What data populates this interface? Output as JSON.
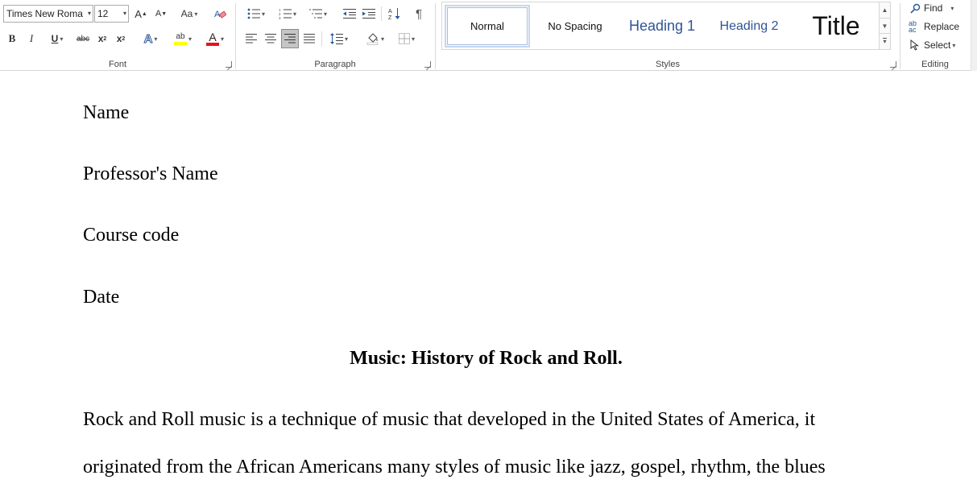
{
  "ribbon": {
    "font": {
      "group_label": "Font",
      "font_name": "Times New Roma",
      "font_size": "12",
      "grow_label": "A",
      "shrink_label": "A",
      "case_label": "Aa",
      "bold": "B",
      "italic": "I",
      "underline": "U",
      "strike": "abc",
      "subscript": "x",
      "superscript": "x",
      "effects": "A",
      "highlight": "ab",
      "font_color": "A",
      "highlight_color": "#ffff00",
      "font_color_bar": "#e81123"
    },
    "paragraph": {
      "group_label": "Paragraph",
      "pilcrow": "¶"
    },
    "styles": {
      "group_label": "Styles",
      "items": [
        {
          "label": "Normal"
        },
        {
          "label": "No Spacing"
        },
        {
          "label": "Heading 1"
        },
        {
          "label": "Heading 2"
        },
        {
          "label": "Title"
        }
      ]
    },
    "editing": {
      "group_label": "Editing",
      "find": "Find",
      "replace": "Replace",
      "select": "Select"
    }
  },
  "document": {
    "lines": [
      "Name",
      "Professor's Name",
      "Course code",
      "Date"
    ],
    "title": "Music: History of Rock and Roll.",
    "body_lines": [
      "Rock and Roll music is a technique of music that developed in the United States of America, it",
      "originated from the African Americans many styles of music like jazz, gospel, rhythm, the blues"
    ]
  },
  "colors": {
    "accent": "#2b579a",
    "heading_blue": "#2f5496",
    "active_button": "#c5c5c5"
  }
}
